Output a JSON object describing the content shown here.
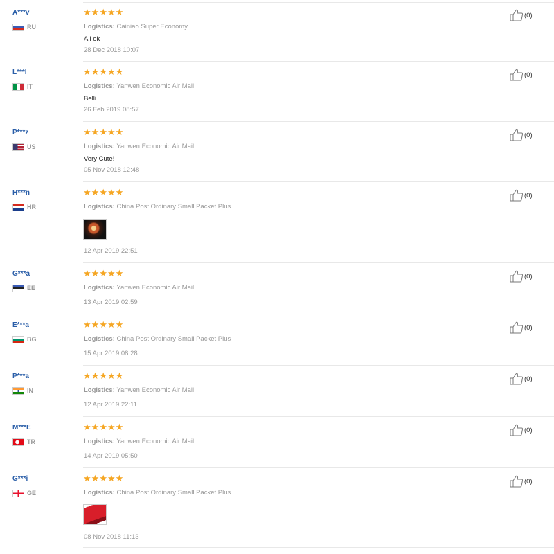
{
  "reviews": [
    {
      "user": "A***v",
      "country": "RU",
      "logistics_label": "Logistics:",
      "logistics": "Cainiao Super Economy",
      "comment": "All ok",
      "date": "28 Dec 2018 10:07",
      "helpful": "(0)",
      "stars": 5
    },
    {
      "user": "L***l",
      "country": "IT",
      "logistics_label": "Logistics:",
      "logistics": "Yanwen Economic Air Mail",
      "comment": "Belli",
      "date": "26 Feb 2019 08:57",
      "helpful": "(0)",
      "stars": 5
    },
    {
      "user": "P***z",
      "country": "US",
      "logistics_label": "Logistics:",
      "logistics": "Yanwen Economic Air Mail",
      "comment": "Very Cute!",
      "date": "05 Nov 2018 12:48",
      "helpful": "(0)",
      "stars": 5
    },
    {
      "user": "H***n",
      "country": "HR",
      "logistics_label": "Logistics:",
      "logistics": "China Post Ordinary Small Packet Plus",
      "date": "12 Apr 2019 22:51",
      "helpful": "(0)",
      "stars": 5
    },
    {
      "user": "G***a",
      "country": "EE",
      "logistics_label": "Logistics:",
      "logistics": "Yanwen Economic Air Mail",
      "date": "13 Apr 2019 02:59",
      "helpful": "(0)",
      "stars": 5
    },
    {
      "user": "E***a",
      "country": "BG",
      "logistics_label": "Logistics:",
      "logistics": "China Post Ordinary Small Packet Plus",
      "date": "15 Apr 2019 08:28",
      "helpful": "(0)",
      "stars": 5
    },
    {
      "user": "P***a",
      "country": "IN",
      "logistics_label": "Logistics:",
      "logistics": "Yanwen Economic Air Mail",
      "date": "12 Apr 2019 22:11",
      "helpful": "(0)",
      "stars": 5
    },
    {
      "user": "M***E",
      "country": "TR",
      "logistics_label": "Logistics:",
      "logistics": "Yanwen Economic Air Mail",
      "date": "14 Apr 2019 05:50",
      "helpful": "(0)",
      "stars": 5
    },
    {
      "user": "G***i",
      "country": "GE",
      "logistics_label": "Logistics:",
      "logistics": "China Post Ordinary Small Packet Plus",
      "date": "08 Nov 2018 11:13",
      "helpful": "(0)",
      "stars": 5
    }
  ],
  "colors": {
    "star": "#f5a623",
    "username": "#2a5ea8",
    "muted": "#999999"
  },
  "icons": {
    "star": "star-icon",
    "helpful": "thumbs-up-icon"
  }
}
